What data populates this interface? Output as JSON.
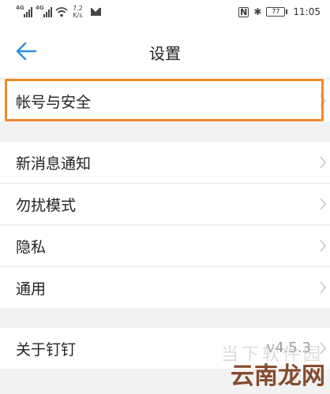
{
  "status_bar": {
    "signal_1_label": "4G",
    "signal_2_label": "4G",
    "speed_value": "7.2",
    "speed_unit": "K/s",
    "nfc_label": "N",
    "bluetooth_label": "✱",
    "battery_level": "77",
    "time": "11:05"
  },
  "nav": {
    "title": "设置",
    "back_icon": "arrow-left-icon"
  },
  "colors": {
    "accent": "#2a8de6",
    "highlight": "#f08a2d"
  },
  "settings": {
    "account_security": "帐号与安全",
    "new_message_notification": "新消息通知",
    "do_not_disturb": "勿扰模式",
    "privacy": "隐私",
    "general": "通用",
    "about": "关于钉钉",
    "version": "v4.5.3"
  },
  "watermark": {
    "main": "云南龙网",
    "ghost": "当下软件园"
  }
}
